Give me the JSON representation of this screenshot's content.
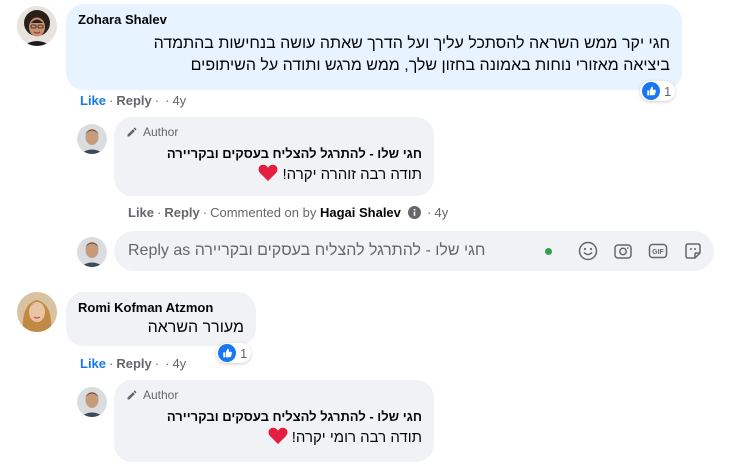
{
  "comments": [
    {
      "author": "Zohara Shalev",
      "text_lines": [
        "חגי יקר ממש השראה להסתכל עליך ועל הדרך שאתה עושה בנחישות בהתמדה",
        "ביציאה מאזורי נוחות באמונה בחזון שלך, ממש מרגש ותודה על השיתופים"
      ],
      "actions": {
        "like": "Like",
        "reply": "Reply",
        "dot": "·",
        "time": "4y"
      },
      "reaction_count": "1"
    },
    {
      "author": "Romi Kofman Atzmon",
      "text": "מעורר השראה",
      "actions": {
        "like": "Like",
        "reply": "Reply",
        "dot": "·",
        "time": "4y"
      },
      "reaction_count": "1"
    }
  ],
  "replies": [
    {
      "badge": "Author",
      "page_name": "חגי שלו - להתרגל להצליח בעסקים ובקריירה",
      "text": "תודה רבה זוהרה יקרה!",
      "actions": {
        "like": "Like",
        "reply": "Reply",
        "commented_on_by": "Commented on by",
        "by_name": "Hagai Shalev",
        "time": "4y"
      }
    },
    {
      "badge": "Author",
      "page_name": "חגי שלו - להתרגל להצליח בעסקים ובקריירה",
      "text": "תודה רבה רומי יקרה!"
    }
  ],
  "reply_input": {
    "placeholder": "Reply as חגי שלו - להתרגל להצליח בעסקים ובקריירה"
  },
  "colors": {
    "accent_blue": "#1877f2",
    "bubble_blue": "#e7f3ff",
    "bubble_grey": "#f0f2f5",
    "muted": "#65676b",
    "online": "#31a24c",
    "heart": "#e41e3f"
  },
  "icons": [
    "like-icon",
    "pencil-icon",
    "info-icon",
    "emoji-icon",
    "camera-icon",
    "gif-icon",
    "sticker-icon",
    "heart-icon"
  ]
}
